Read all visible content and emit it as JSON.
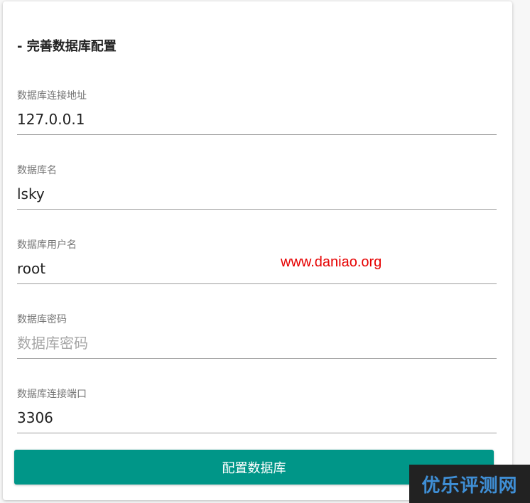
{
  "form": {
    "title": "- 完善数据库配置",
    "fields": [
      {
        "label": "数据库连接地址",
        "value": "127.0.0.1",
        "placeholder": ""
      },
      {
        "label": "数据库名",
        "value": "lsky",
        "placeholder": ""
      },
      {
        "label": "数据库用户名",
        "value": "root",
        "placeholder": ""
      },
      {
        "label": "数据库密码",
        "value": "",
        "placeholder": "数据库密码"
      },
      {
        "label": "数据库连接端口",
        "value": "3306",
        "placeholder": ""
      }
    ],
    "submit_label": "配置数据库"
  },
  "watermarks": {
    "url": "www.daniao.org",
    "badge": "优乐评测网"
  },
  "colors": {
    "accent": "#009688",
    "watermark_url": "#e60000",
    "badge_bg": "#222222",
    "badge_text": "#3f8fd6"
  }
}
